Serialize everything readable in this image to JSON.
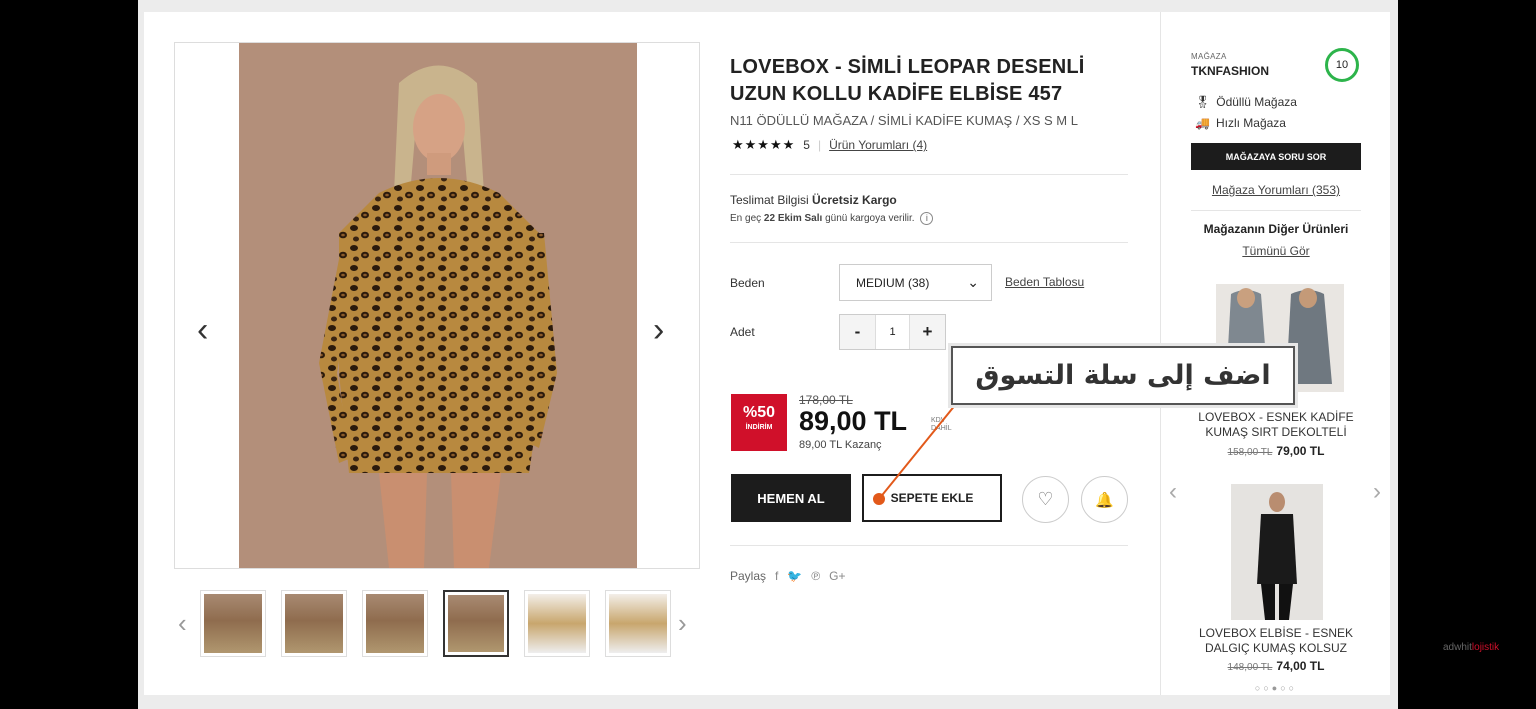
{
  "product": {
    "title": "LOVEBOX - SİMLİ LEOPAR DESENLİ UZUN KOLLU KADİFE ELBİSE 457",
    "subtitle": "N11 ÖDÜLLÜ MAĞAZA / SİMLİ KADİFE KUMAŞ / XS S M L",
    "stars": "★★★★★",
    "rating": "5",
    "reviews_link": "Ürün Yorumları (4)"
  },
  "delivery": {
    "label": "Teslimat Bilgisi",
    "value": "Ücretsiz Kargo",
    "note_prefix": "En geç",
    "note_date": "22 Ekim Salı",
    "note_suffix": "günü kargoya verilir.",
    "info_icon": "i"
  },
  "options": {
    "size_label": "Beden",
    "size_value": "MEDIUM (38)",
    "size_chevron": "⌄",
    "size_table_link": "Beden Tablosu",
    "qty_label": "Adet",
    "qty_minus": "-",
    "qty_value": "1",
    "qty_plus": "+"
  },
  "pricing": {
    "badge_pct": "%50",
    "badge_text": "İNDİRİM",
    "old_price": "178,00 TL",
    "price": "89,00 TL",
    "kdv": "KDV DAHİL",
    "earn": "89,00 TL Kazanç"
  },
  "actions": {
    "buy_now": "HEMEN AL",
    "add_to_cart": "SEPETE EKLE",
    "favorite_icon": "♡",
    "alert_icon": "🔔"
  },
  "share": {
    "label": "Paylaş",
    "icons": [
      "f",
      "🐦",
      "℗",
      "G+"
    ]
  },
  "callout": {
    "text": "اضف إلى سلة التسوق"
  },
  "gallery": {
    "prev": "‹",
    "next": "›",
    "thumb_prev": "‹",
    "thumb_next": "›",
    "active_thumb": 3
  },
  "store": {
    "caption": "MAĞAZA",
    "name": "TKNFASHION",
    "score": "10",
    "badge1_icon": "🎖",
    "badge1": "Ödüllü Mağaza",
    "badge2_icon": "🚚",
    "badge2": "Hızlı Mağaza",
    "ask_button": "MAĞAZAYA SORU SOR",
    "reviews_link": "Mağaza Yorumları (353)",
    "other_heading": "Mağazanın Diğer Ürünleri",
    "see_all": "Tümünü Gör",
    "prev": "‹",
    "next": "›",
    "products": [
      {
        "name": "LOVEBOX - ESNEK KADİFE KUMAŞ SIRT DEKOLTELİ",
        "old_price": "158,00 TL",
        "price": "79,00 TL"
      },
      {
        "name": "LOVEBOX ELBİSE - ESNEK DALGIÇ KUMAŞ KOLSUZ",
        "old_price": "148,00 TL",
        "price": "74,00 TL"
      }
    ],
    "dots": "○○●○○"
  },
  "watermark": {
    "part1": "adwhit",
    "part2": "lojistik"
  },
  "colors": {
    "accent_red": "#d0102a",
    "dark_button": "#1c1c1c",
    "score_green": "#2db44b",
    "cursor_dot": "#e2591a"
  }
}
